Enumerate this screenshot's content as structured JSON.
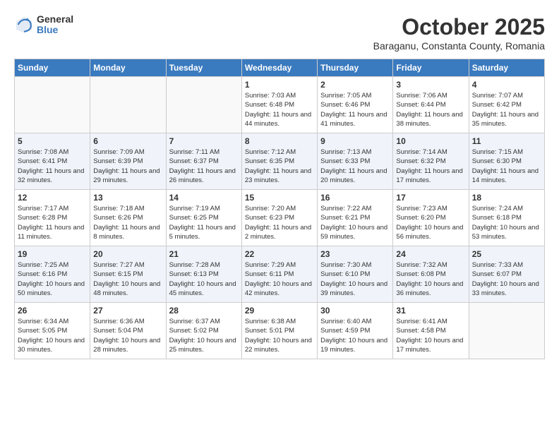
{
  "header": {
    "logo_general": "General",
    "logo_blue": "Blue",
    "month_title": "October 2025",
    "subtitle": "Baraganu, Constanta County, Romania"
  },
  "days_of_week": [
    "Sunday",
    "Monday",
    "Tuesday",
    "Wednesday",
    "Thursday",
    "Friday",
    "Saturday"
  ],
  "weeks": [
    [
      {
        "num": "",
        "info": ""
      },
      {
        "num": "",
        "info": ""
      },
      {
        "num": "",
        "info": ""
      },
      {
        "num": "1",
        "info": "Sunrise: 7:03 AM\nSunset: 6:48 PM\nDaylight: 11 hours\nand 44 minutes."
      },
      {
        "num": "2",
        "info": "Sunrise: 7:05 AM\nSunset: 6:46 PM\nDaylight: 11 hours\nand 41 minutes."
      },
      {
        "num": "3",
        "info": "Sunrise: 7:06 AM\nSunset: 6:44 PM\nDaylight: 11 hours\nand 38 minutes."
      },
      {
        "num": "4",
        "info": "Sunrise: 7:07 AM\nSunset: 6:42 PM\nDaylight: 11 hours\nand 35 minutes."
      }
    ],
    [
      {
        "num": "5",
        "info": "Sunrise: 7:08 AM\nSunset: 6:41 PM\nDaylight: 11 hours\nand 32 minutes."
      },
      {
        "num": "6",
        "info": "Sunrise: 7:09 AM\nSunset: 6:39 PM\nDaylight: 11 hours\nand 29 minutes."
      },
      {
        "num": "7",
        "info": "Sunrise: 7:11 AM\nSunset: 6:37 PM\nDaylight: 11 hours\nand 26 minutes."
      },
      {
        "num": "8",
        "info": "Sunrise: 7:12 AM\nSunset: 6:35 PM\nDaylight: 11 hours\nand 23 minutes."
      },
      {
        "num": "9",
        "info": "Sunrise: 7:13 AM\nSunset: 6:33 PM\nDaylight: 11 hours\nand 20 minutes."
      },
      {
        "num": "10",
        "info": "Sunrise: 7:14 AM\nSunset: 6:32 PM\nDaylight: 11 hours\nand 17 minutes."
      },
      {
        "num": "11",
        "info": "Sunrise: 7:15 AM\nSunset: 6:30 PM\nDaylight: 11 hours\nand 14 minutes."
      }
    ],
    [
      {
        "num": "12",
        "info": "Sunrise: 7:17 AM\nSunset: 6:28 PM\nDaylight: 11 hours\nand 11 minutes."
      },
      {
        "num": "13",
        "info": "Sunrise: 7:18 AM\nSunset: 6:26 PM\nDaylight: 11 hours\nand 8 minutes."
      },
      {
        "num": "14",
        "info": "Sunrise: 7:19 AM\nSunset: 6:25 PM\nDaylight: 11 hours\nand 5 minutes."
      },
      {
        "num": "15",
        "info": "Sunrise: 7:20 AM\nSunset: 6:23 PM\nDaylight: 11 hours\nand 2 minutes."
      },
      {
        "num": "16",
        "info": "Sunrise: 7:22 AM\nSunset: 6:21 PM\nDaylight: 10 hours\nand 59 minutes."
      },
      {
        "num": "17",
        "info": "Sunrise: 7:23 AM\nSunset: 6:20 PM\nDaylight: 10 hours\nand 56 minutes."
      },
      {
        "num": "18",
        "info": "Sunrise: 7:24 AM\nSunset: 6:18 PM\nDaylight: 10 hours\nand 53 minutes."
      }
    ],
    [
      {
        "num": "19",
        "info": "Sunrise: 7:25 AM\nSunset: 6:16 PM\nDaylight: 10 hours\nand 50 minutes."
      },
      {
        "num": "20",
        "info": "Sunrise: 7:27 AM\nSunset: 6:15 PM\nDaylight: 10 hours\nand 48 minutes."
      },
      {
        "num": "21",
        "info": "Sunrise: 7:28 AM\nSunset: 6:13 PM\nDaylight: 10 hours\nand 45 minutes."
      },
      {
        "num": "22",
        "info": "Sunrise: 7:29 AM\nSunset: 6:11 PM\nDaylight: 10 hours\nand 42 minutes."
      },
      {
        "num": "23",
        "info": "Sunrise: 7:30 AM\nSunset: 6:10 PM\nDaylight: 10 hours\nand 39 minutes."
      },
      {
        "num": "24",
        "info": "Sunrise: 7:32 AM\nSunset: 6:08 PM\nDaylight: 10 hours\nand 36 minutes."
      },
      {
        "num": "25",
        "info": "Sunrise: 7:33 AM\nSunset: 6:07 PM\nDaylight: 10 hours\nand 33 minutes."
      }
    ],
    [
      {
        "num": "26",
        "info": "Sunrise: 6:34 AM\nSunset: 5:05 PM\nDaylight: 10 hours\nand 30 minutes."
      },
      {
        "num": "27",
        "info": "Sunrise: 6:36 AM\nSunset: 5:04 PM\nDaylight: 10 hours\nand 28 minutes."
      },
      {
        "num": "28",
        "info": "Sunrise: 6:37 AM\nSunset: 5:02 PM\nDaylight: 10 hours\nand 25 minutes."
      },
      {
        "num": "29",
        "info": "Sunrise: 6:38 AM\nSunset: 5:01 PM\nDaylight: 10 hours\nand 22 minutes."
      },
      {
        "num": "30",
        "info": "Sunrise: 6:40 AM\nSunset: 4:59 PM\nDaylight: 10 hours\nand 19 minutes."
      },
      {
        "num": "31",
        "info": "Sunrise: 6:41 AM\nSunset: 4:58 PM\nDaylight: 10 hours\nand 17 minutes."
      },
      {
        "num": "",
        "info": ""
      }
    ]
  ]
}
